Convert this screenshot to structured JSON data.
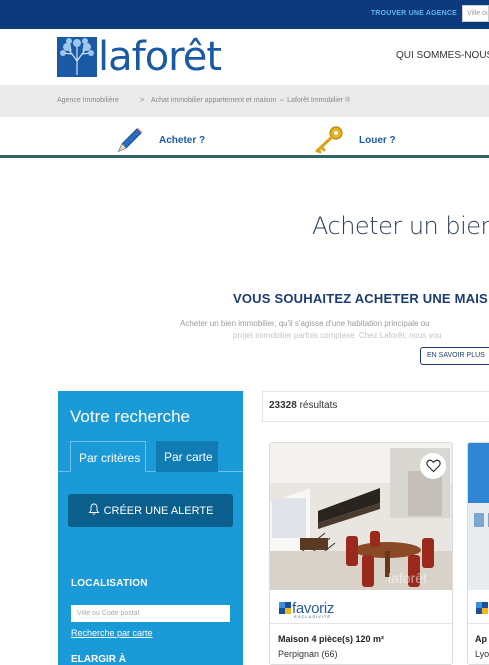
{
  "topbar": {
    "find_agency": "TROUVER UNE AGENCE",
    "city_placeholder": "Ville ou"
  },
  "header": {
    "logo_text": "laforêt",
    "nav_who": "QUI SOMMES-NOUS"
  },
  "breadcrumb": {
    "home": "Agence Immobilière",
    "separator": ">",
    "current": "Achat immobilier appartement et maison ⇔ Laforêt Immobilier ®"
  },
  "actions": {
    "buy": "Acheter ?",
    "rent": "Louer ?"
  },
  "page": {
    "title": "Acheter un bien",
    "intro_title": "VOUS SOUHAITEZ ACHETER UNE MAIS",
    "intro_line1": "Acheter un bien immobilier, qu'il s'agisse d'une habitation principale ou",
    "intro_line2": "projet immobilier parfois complexe. Chez Laforêt, nous vou",
    "more_button": "EN SAVOIR PLUS"
  },
  "search": {
    "title": "Votre recherche",
    "tab_criteria": "Par critères",
    "tab_map": "Par carte",
    "alert_button": "CRÉER UNE ALERTE",
    "location_heading": "LOCALISATION",
    "location_placeholder": "Ville ou Code postal",
    "map_link": "Recherche par carte",
    "widen_heading": "ELARGIR À"
  },
  "results": {
    "count": "23328",
    "label": "résultats"
  },
  "cards": [
    {
      "brand": "favoriz",
      "brand_sub": "EXCLUSIVITÉ",
      "title": "Maison 4 pièce(s) 120 m²",
      "location": "Perpignan (66)"
    },
    {
      "title": "Ap",
      "location": "Lyo"
    }
  ],
  "colors": {
    "topbar": "#0d3a7c",
    "brand_blue": "#1a5aa5",
    "panel": "#1a9ad6",
    "alert_button": "#0b5f8c",
    "action_rule": "#2f6466"
  }
}
